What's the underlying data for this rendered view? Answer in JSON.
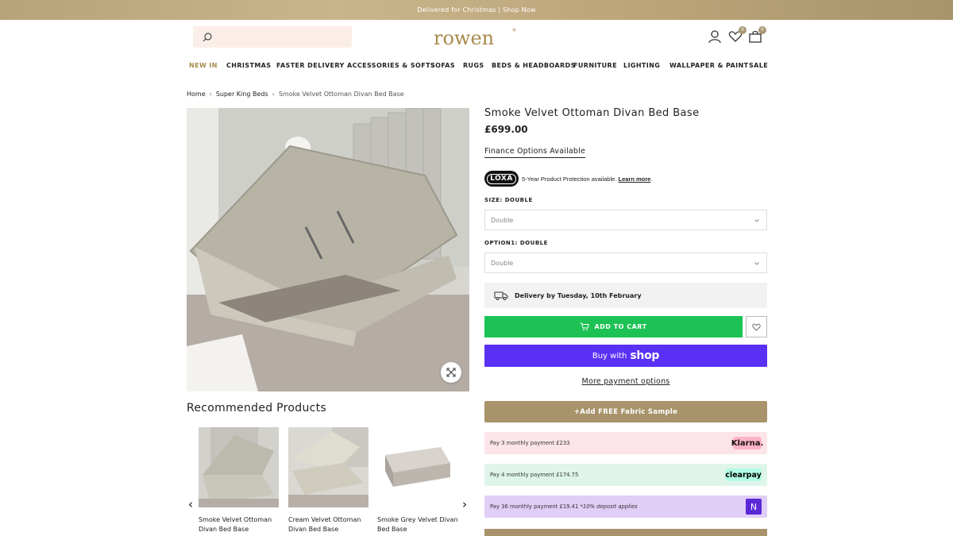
{
  "promo": {
    "text": "Delivered for Christmas | Shop Now"
  },
  "header": {
    "search_placeholder": "",
    "logo": "rowen",
    "wishlist_count": "0",
    "cart_count": "0"
  },
  "nav": {
    "items": [
      "NEW IN",
      "CHRISTMAS",
      "FASTER DELIVERY",
      "ACCESSORIES & SOFTS",
      "SOFAS",
      "RUGS",
      "BEDS & HEADBOARDS",
      "FURNITURE",
      "LIGHTING",
      "WALLPAPER & PAINT",
      "SALE"
    ]
  },
  "breadcrumb": {
    "home": "Home",
    "category": "Super King Beds",
    "current": "Smoke Velvet Ottoman Divan Bed Base"
  },
  "product": {
    "title": "Smoke Velvet Ottoman Divan Bed Base",
    "price": "£699.00",
    "finance_link": "Finance Options Available",
    "loxa": {
      "badge": "LOXA",
      "text": "5-Year Product Protection available.",
      "learn_more": "Learn more",
      "suffix": "."
    },
    "size_label": "SIZE: DOUBLE",
    "size_value": "Double",
    "option1_label": "OPTION1: DOUBLE",
    "option1_value": "Double",
    "delivery_text": "Delivery by Tuesday, 10th February",
    "add_to_cart": "ADD TO CART",
    "buy_with": "Buy with",
    "shop": "shop",
    "more_payment": "More payment options",
    "fabric_sample": "+Add FREE Fabric Sample"
  },
  "payments": [
    {
      "text": "Pay 3 monthly payment £233",
      "note": "",
      "brand": "Klarna."
    },
    {
      "text": "Pay 4 monthly payment £174.75",
      "note": "",
      "brand": "clearpay"
    },
    {
      "text": "Pay 36 monthly payment £19.41",
      "note": "*10% deposit applies",
      "brand": "N"
    }
  ],
  "recommended": {
    "title": "Recommended Products",
    "items": [
      {
        "name": "Smoke Velvet Ottoman Divan Bed Base"
      },
      {
        "name": "Cream Velvet Ottoman Divan Bed Base"
      },
      {
        "name": "Smoke Grey Velvet Divan Bed Base"
      }
    ]
  },
  "colors": {
    "gold": "#a8936b",
    "add_to_cart_green": "#1cc254",
    "shop_pay_purple": "#5a31f4",
    "klarna_pink": "#ffb3c7",
    "clearpay_mint": "#b2fce4"
  },
  "icons": [
    "search-icon",
    "account-icon",
    "wishlist-icon",
    "bag-icon",
    "zoom-icon",
    "truck-icon",
    "cart-icon",
    "heart-icon",
    "chevron-down-icon",
    "chevron-left-icon",
    "chevron-right-icon"
  ]
}
